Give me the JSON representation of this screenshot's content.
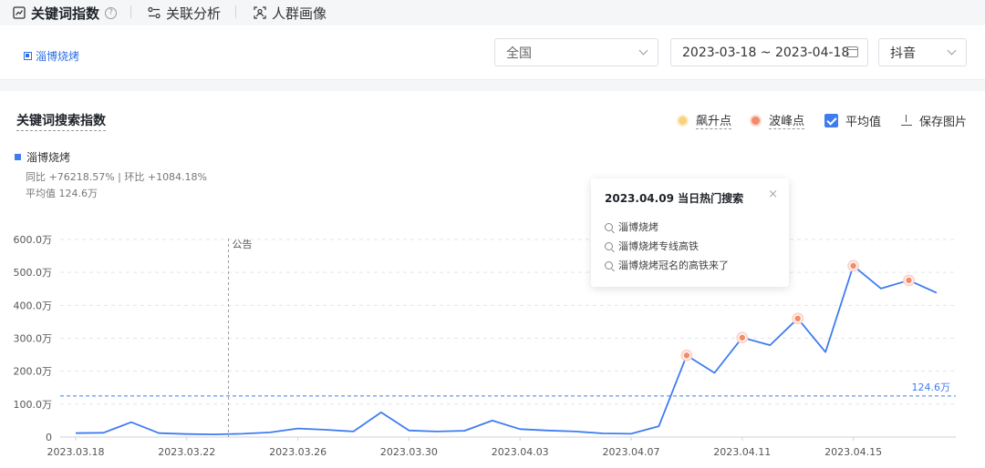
{
  "tabs": [
    {
      "label": "关键词指数",
      "icon": "trend-chart-icon",
      "active": true
    },
    {
      "label": "关联分析",
      "icon": "relation-icon",
      "active": false
    },
    {
      "label": "人群画像",
      "icon": "person-scan-icon",
      "active": false
    }
  ],
  "help_mark": "?",
  "filters": {
    "keyword_tag": "淄博烧烤",
    "region": "全国",
    "date_range": "2023-03-18 ~ 2023-04-18",
    "platform": "抖音"
  },
  "panel": {
    "title": "关键词搜索指数",
    "tools": {
      "surge_label": "飙升点",
      "peak_label": "波峰点",
      "avg_label": "平均值",
      "avg_checked": true,
      "save_label": "保存图片"
    },
    "legend_name": "淄博烧烤",
    "stat_line": "同比 +76218.57% | 环比 +1084.18%",
    "avg_line": "平均值 124.6万"
  },
  "tooltip": {
    "title": "2023.04.09 当日热门搜索",
    "close": "×",
    "items": [
      "淄博烧烤",
      "淄博烧烤专线高铁",
      "淄博烧烤冠名的高铁来了"
    ]
  },
  "colors": {
    "line": "#3f7cf0",
    "peak": "#f28b6b",
    "avg": "#3f7cf0",
    "grid": "#e3e5ea"
  },
  "chart_data": {
    "type": "line",
    "series": [
      {
        "name": "淄博烧烤",
        "values": [
          12,
          13,
          45,
          12,
          9,
          8,
          10,
          14,
          26,
          22,
          17,
          75,
          20,
          17,
          19,
          50,
          24,
          20,
          17,
          11,
          10,
          33,
          248,
          195,
          302,
          279,
          360,
          258,
          520,
          451,
          476,
          438
        ]
      }
    ],
    "x_dates": [
      "2023.03.18",
      "2023.03.19",
      "2023.03.20",
      "2023.03.21",
      "2023.03.22",
      "2023.03.23",
      "2023.03.24",
      "2023.03.25",
      "2023.03.26",
      "2023.03.27",
      "2023.03.28",
      "2023.03.29",
      "2023.03.30",
      "2023.03.31",
      "2023.04.01",
      "2023.04.02",
      "2023.04.03",
      "2023.04.04",
      "2023.04.05",
      "2023.04.06",
      "2023.04.07",
      "2023.04.08",
      "2023.04.09",
      "2023.04.10",
      "2023.04.11",
      "2023.04.12",
      "2023.04.13",
      "2023.04.14",
      "2023.04.15",
      "2023.04.16",
      "2023.04.17",
      "2023.04.18"
    ],
    "x_tick_labels": [
      "2023.03.18",
      "2023.03.22",
      "2023.03.26",
      "2023.03.30",
      "2023.04.03",
      "2023.04.07",
      "2023.04.11",
      "2023.04.15"
    ],
    "y_tick_labels": [
      "0",
      "100.0万",
      "200.0万",
      "300.0万",
      "400.0万",
      "500.0万",
      "600.0万"
    ],
    "ylim": [
      0,
      600
    ],
    "y_unit": "万",
    "average": 124.6,
    "average_label": "124.6万",
    "peak_dates": [
      "2023.04.09",
      "2023.04.11",
      "2023.04.13",
      "2023.04.15",
      "2023.04.17"
    ],
    "annotation": {
      "label": "公告",
      "between": [
        "2023.03.23",
        "2023.03.24"
      ]
    },
    "grid": true
  }
}
